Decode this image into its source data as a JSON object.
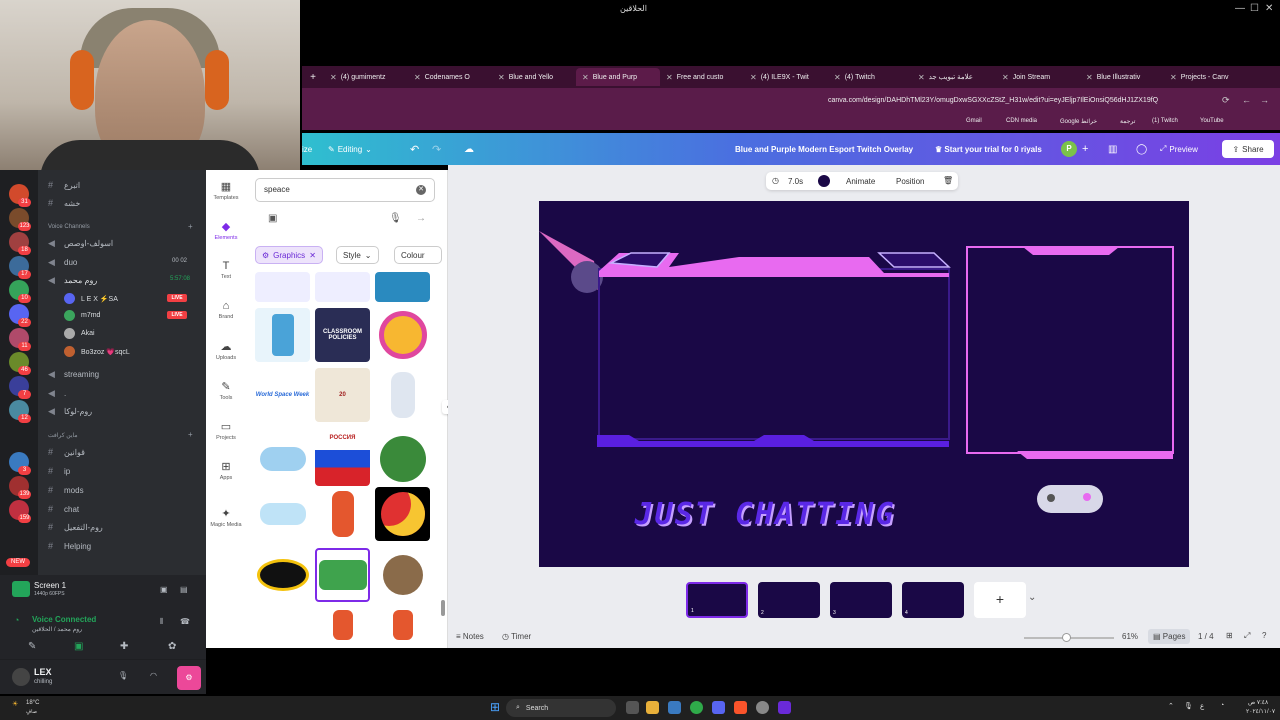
{
  "window": {
    "title": "الحلاقين",
    "controls": [
      "—",
      "☐",
      "✕"
    ]
  },
  "browser": {
    "tabs": [
      {
        "label": "(4) gumimentz",
        "active": false
      },
      {
        "label": "Codenames O",
        "active": false
      },
      {
        "label": "Blue and Yello",
        "active": false
      },
      {
        "label": "Blue and Purp",
        "active": true
      },
      {
        "label": "Free and custo",
        "active": false
      },
      {
        "label": "(4) ILE9X - Twit",
        "active": false
      },
      {
        "label": "(4) Twitch",
        "active": false
      },
      {
        "label": "علامة تبويب جد",
        "active": false
      },
      {
        "label": "Join Stream",
        "active": false
      },
      {
        "label": "Blue Illustrativ",
        "active": false
      },
      {
        "label": "Projects - Canv",
        "active": false
      }
    ],
    "url": "canva.com/design/DAHDhTMl23Y/omugDxwSGXXcZStZ_H31w/edit?ui=eyJEljp7IlEiOnsiQ56dHJ1ZX19fQ",
    "bookmarks": [
      "Gmail",
      "CDN media",
      "Google خرائط",
      "ترجمة",
      "(1) Twitch",
      "YouTube"
    ]
  },
  "canva_header": {
    "resize_label": "ize",
    "editing_label": "Editing",
    "doc_title": "Blue and Purple Modern Esport Twitch Overlay",
    "trial_label": "Start your trial for 0 riyals",
    "avatar_letter": "P",
    "preview_label": "Preview",
    "share_label": "Share"
  },
  "rail": {
    "items": [
      {
        "label": "Templates",
        "icon": "templates-icon"
      },
      {
        "label": "Elements",
        "icon": "elements-icon"
      },
      {
        "label": "Text",
        "icon": "text-icon"
      },
      {
        "label": "Brand",
        "icon": "brand-icon"
      },
      {
        "label": "Uploads",
        "icon": "uploads-icon"
      },
      {
        "label": "Tools",
        "icon": "tools-icon"
      },
      {
        "label": "Projects",
        "icon": "projects-icon"
      },
      {
        "label": "Apps",
        "icon": "apps-icon"
      },
      {
        "label": "Magic Media",
        "icon": "magic-media-icon"
      }
    ]
  },
  "elements_panel": {
    "search_value": "speace",
    "filters": {
      "graphics": "Graphics",
      "style": "Style",
      "colour": "Colour"
    },
    "thumb_texts": {
      "classroom": "CLASSROOM POLICIES",
      "space_week": "World Space Week",
      "russia": "РОССИЯ",
      "date": "20"
    }
  },
  "canvas_toolbar": {
    "duration": "7.0s",
    "animate": "Animate",
    "position": "Position"
  },
  "design": {
    "caption": "JUST CHATTING"
  },
  "pages": {
    "thumbs": [
      "1",
      "2",
      "3",
      "4"
    ],
    "counter": "1 / 4",
    "zoom": "61%",
    "notes": "Notes",
    "timer": "Timer",
    "pages_label": "Pages"
  },
  "discord": {
    "top_channels": [
      "اتبرع",
      "خشه"
    ],
    "voice_category": "Voice Channels",
    "channels": [
      {
        "name": "اسولف-اوصص",
        "type": "voice"
      },
      {
        "name": "duo",
        "type": "voice",
        "meta": "00  02"
      },
      {
        "name": "روم محمد",
        "type": "voice",
        "meta": "5:57:08"
      }
    ],
    "voice_users": [
      {
        "name": "L E X ⚡SA",
        "live": "LIVE"
      },
      {
        "name": "m7md",
        "live": "LIVE"
      },
      {
        "name": "Akai",
        "live": ""
      },
      {
        "name": "Bo3zoz 💗sqcL",
        "live": ""
      }
    ],
    "more_channels": [
      "streaming",
      ".",
      "روم-لوكا"
    ],
    "text_category": "ماين كرافت",
    "text_channels": [
      "قوانين",
      "ip",
      "mods",
      "chat",
      "روم-التفعيل",
      "Helping"
    ],
    "guild_badges": [
      "31",
      "123",
      "18",
      "17",
      "10",
      "22",
      "11",
      "46",
      "7",
      "12",
      "3",
      "139",
      "159",
      "NEW"
    ],
    "screen_share": {
      "title": "Screen 1",
      "sub": "1440p 60FPS"
    },
    "voice_connected": {
      "title": "Voice Connected",
      "sub": "روم محمد / الحلاقين"
    },
    "user": {
      "name": "LEX",
      "status": "chilling"
    }
  },
  "taskbar": {
    "weather": "18°C",
    "weather_sub": "صافٍ",
    "search_label": "Search",
    "time": "٧:٤٨ ص",
    "date": "٢٠٢٤/١١/٠٧"
  },
  "colors": {
    "canva_purple": "#7d2ae8",
    "design_bg": "#1a0846",
    "neon_pink": "#e86af0",
    "neon_purple": "#6a1fe0",
    "discord_bg": "#2b2d31"
  }
}
